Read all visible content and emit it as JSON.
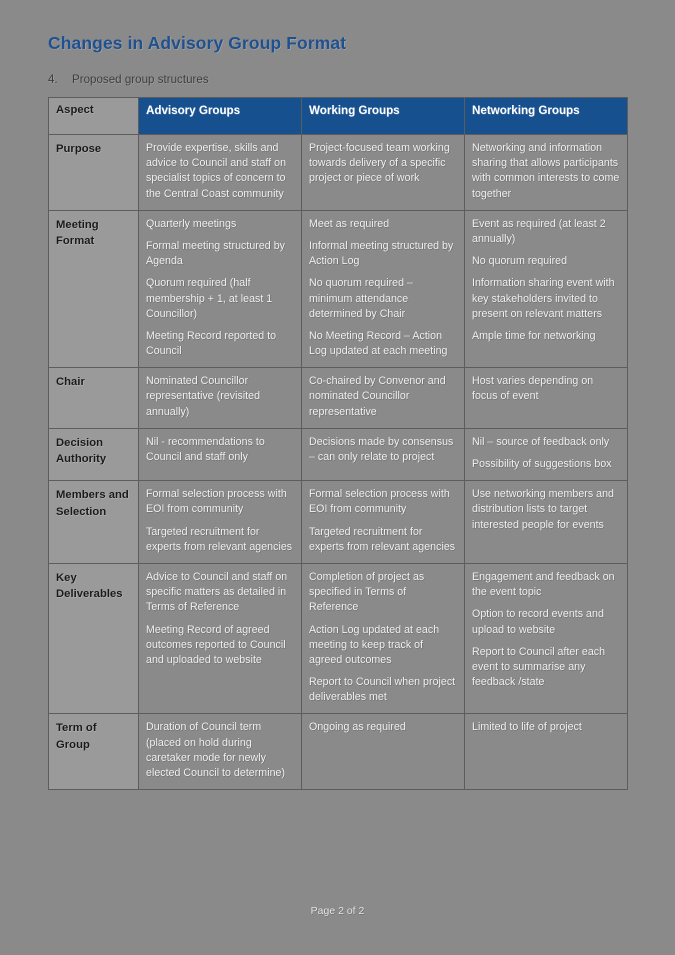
{
  "document": {
    "title": "Changes in Advisory Group Format",
    "section_number": "4.",
    "section_heading": "Proposed group structures",
    "footer": "Page 2 of 2",
    "accent_color": "#1f5090",
    "header_background": "#17508f",
    "page_background": "#8a8a8a"
  },
  "table": {
    "columns": [
      {
        "key": "aspect",
        "label": "Aspect"
      },
      {
        "key": "advisory",
        "label": "Advisory Groups"
      },
      {
        "key": "working",
        "label": "Working Groups"
      },
      {
        "key": "networking",
        "label": "Networking Groups"
      }
    ],
    "rows": [
      {
        "aspect": "Purpose",
        "advisory": [
          "Provide expertise, skills and advice to Council and staff on specialist topics of concern to the Central Coast community"
        ],
        "working": [
          "Project-focused team working towards delivery of a specific project or piece of work"
        ],
        "networking": [
          "Networking and information sharing that allows participants with common interests to come together"
        ]
      },
      {
        "aspect": "Meeting Format",
        "advisory": [
          "Quarterly meetings",
          "Formal meeting structured by Agenda",
          "Quorum required (half membership + 1, at least 1 Councillor)",
          "Meeting Record reported to Council"
        ],
        "working": [
          "Meet as required",
          "Informal meeting structured by Action Log",
          "No quorum required – minimum attendance determined by Chair",
          "No Meeting Record – Action Log updated at each meeting"
        ],
        "networking": [
          "Event as required (at least 2 annually)",
          "No quorum required",
          "Information sharing event with key stakeholders invited to present on relevant matters",
          "Ample time for networking"
        ]
      },
      {
        "aspect": "Chair",
        "advisory": [
          "Nominated Councillor representative (revisited annually)"
        ],
        "working": [
          "Co-chaired by Convenor and nominated Councillor representative"
        ],
        "networking": [
          "Host varies depending on focus of event"
        ]
      },
      {
        "aspect": "Decision Authority",
        "advisory": [
          "Nil - recommendations to Council and staff only"
        ],
        "working": [
          "Decisions made by consensus – can only relate to project"
        ],
        "networking": [
          "Nil – source of feedback only",
          "Possibility of suggestions box"
        ]
      },
      {
        "aspect": "Members and Selection",
        "advisory": [
          "Formal selection process with EOI from community",
          "Targeted recruitment for experts from relevant agencies"
        ],
        "working": [
          "Formal selection process with EOI from community",
          "Targeted recruitment for experts from relevant agencies"
        ],
        "networking": [
          "Use networking members and distribution lists to target interested people for events"
        ]
      },
      {
        "aspect": "Key Deliverables",
        "advisory": [
          "Advice to Council and staff on specific matters as detailed in Terms of Reference",
          "Meeting Record of agreed outcomes reported to Council and uploaded to website"
        ],
        "working": [
          "Completion of project as specified in Terms of Reference",
          "Action Log updated at each meeting to keep track of agreed outcomes",
          "Report to Council when project deliverables met"
        ],
        "networking": [
          "Engagement and feedback on the event topic",
          "Option to record events and upload to website",
          "Report to Council after each event to summarise any feedback /state"
        ]
      },
      {
        "aspect": "Term of Group",
        "advisory": [
          "Duration of Council term (placed on hold during caretaker mode for newly elected Council to determine)"
        ],
        "working": [
          "Ongoing as required"
        ],
        "networking": [
          "Limited to life of project"
        ]
      }
    ]
  }
}
